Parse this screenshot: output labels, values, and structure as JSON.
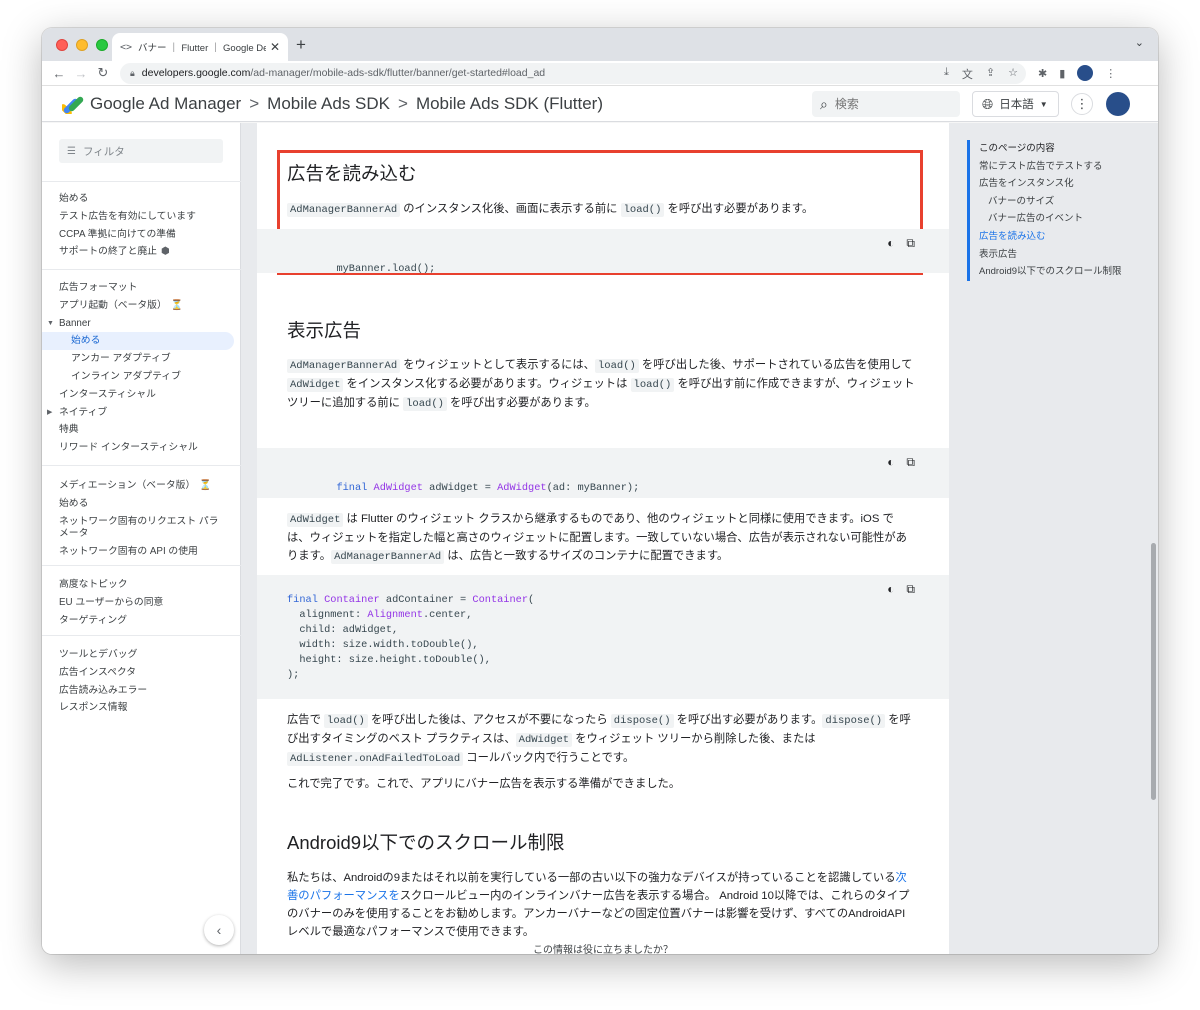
{
  "browser": {
    "tab_title": "バナー ｜ Flutter ｜ Google Deve",
    "tab_favicon": "<>",
    "url_host": "developers.google.com",
    "url_path": "/ad-manager/mobile-ads-sdk/flutter/banner/get-started#load_ad"
  },
  "header": {
    "brand": "Google Ad Manager",
    "crumb1": "Mobile Ads SDK",
    "crumb2": "Mobile Ads SDK (Flutter)",
    "separator": ">",
    "search_placeholder": "検索",
    "language": "日本語"
  },
  "sidebar": {
    "filter_placeholder": "フィルタ",
    "group1": [
      "始める",
      "テスト広告を有効にしています",
      "CCPA 準拠に向けての準備",
      "サポートの終了と廃止"
    ],
    "group2": {
      "formats": "広告フォーマット",
      "app_open": "アプリ起動（ベータ版）",
      "banner": "Banner",
      "start": "始める",
      "anchor": "アンカー アダプティブ",
      "inline": "インライン アダプティブ",
      "interstitial": "インタースティシャル",
      "native": "ネイティブ",
      "special": "特典",
      "rewarded_interstitial": "リワード インタースティシャル"
    },
    "group3": [
      "メディエーション（ベータ版）",
      "始める",
      "ネットワーク固有のリクエスト パラメータ",
      "ネットワーク固有の API の使用"
    ],
    "group4": [
      "高度なトピック",
      "EU ユーザーからの同意",
      "ターゲティング"
    ],
    "group5": [
      "ツールとデバッグ",
      "広告インスペクタ",
      "広告読み込みエラー",
      "レスポンス情報"
    ]
  },
  "content": {
    "load_heading": "広告を読み込む",
    "load_para_code1": "AdManagerBannerAd",
    "load_para_text1": " のインスタンス化後、画面に表示する前に ",
    "load_para_code2": "load()",
    "load_para_text2": " を呼び出す必要があります。",
    "load_code": "myBanner.load();",
    "display_heading": "表示広告",
    "display_p1": {
      "c1": "AdManagerBannerAd",
      "t1": " をウィジェットとして表示するには、",
      "c2": "load()",
      "t2": " を呼び出した後、サポートされている広告を使用して ",
      "c3": "AdWidget",
      "t3": " をインスタンス化する必要があります。ウィジェットは ",
      "c4": "load()",
      "t4": " を呼び出す前に作成できますが、ウィジェット ツリーに追加する前に ",
      "c5": "load()",
      "t5": " を呼び出す必要があります。"
    },
    "code2": {
      "kw": "final",
      "ty1": "AdWidget",
      "mid": " adWidget = ",
      "ty2": "AdWidget",
      "end": "(ad: myBanner);"
    },
    "display_p2": {
      "c1": "AdWidget",
      "t1": " は Flutter のウィジェット クラスから継承するものであり、他のウィジェットと同様に使用できます。iOS では、ウィジェットを指定した幅と高さのウィジェットに配置します。一致していない場合、広告が表示されない可能性があります。",
      "c2": "AdManagerBannerAd",
      "t2": " は、広告と一致するサイズのコンテナに配置できます。"
    },
    "code3": {
      "kw": "final",
      "ty1": "Container",
      "mid": " adContainer = ",
      "ty2": "Container",
      "open": "(",
      "l2a": "  alignment: ",
      "ty3": "Alignment",
      "l2b": ".center,",
      "l3": "  child: adWidget,",
      "l4": "  width: size.width.toDouble(),",
      "l5": "  height: size.height.toDouble(),",
      "l6": ");"
    },
    "display_p3": {
      "t0": "広告で ",
      "c1": "load()",
      "t1": " を呼び出した後は、アクセスが不要になったら ",
      "c2": "dispose()",
      "t2": " を呼び出す必要があります。",
      "c3": "dispose()",
      "t3": " を呼び出すタイミングのベスト プラクティスは、",
      "c4": "AdWidget",
      "t4": " をウィジェット ツリーから削除した後、または ",
      "c5": "AdListener.onAdFailedToLoad",
      "t5": " コールバック内で行うことです。"
    },
    "display_p4": "これで完了です。これで、アプリにバナー広告を表示する準備ができました。",
    "android_heading": "Android9以下でのスクロール制限",
    "android_p": {
      "t1": "私たちは、Androidの9またはそれ以前を実行している一部の古い以下の強力なデバイスが持っていることを認識している",
      "link": "次善のパフォーマンスを",
      "t2": "スクロールビュー内のインラインバナー広告を表示する場合。 Android 10以降では、これらのタイプのバナーのみを使用することをお勧めします。アンカーバナーなどの固定位置バナーは影響を受けず、すべてのAndroidAPIレベルで最適なパフォーマンスで使用できます。"
    },
    "feedback": "この情報は役に立ちましたか？"
  },
  "toc": {
    "title": "このページの内容",
    "items": [
      "常にテスト広告でテストする",
      "広告をインスタンス化",
      "バナーのサイズ",
      "バナー広告のイベント",
      "広告を読み込む",
      "表示広告",
      "Android9以下でのスクロール制限"
    ]
  },
  "colors": {
    "accent": "#1a73e8",
    "highlight": "#e8402e",
    "code_bg": "#f1f3f4"
  }
}
